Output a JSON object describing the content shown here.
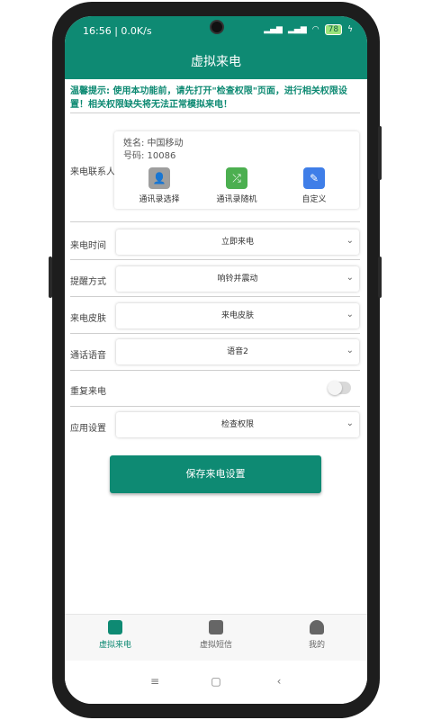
{
  "status_bar": {
    "time": "16:56 | 0.0K/s",
    "battery": "78"
  },
  "app_bar": {
    "title": "虚拟来电"
  },
  "notice": {
    "text": "温馨提示: 使用本功能前，请先打开\"检查权限\"页面，进行相关权限设置！相关权限缺失将无法正常模拟来电！"
  },
  "contact": {
    "label": "来电联系人",
    "name": "姓名: 中国移动",
    "number": "号码: 10086",
    "buttons": [
      {
        "label": "通讯录选择",
        "icon": "contacts-icon"
      },
      {
        "label": "通讯录随机",
        "icon": "shuffle-icon"
      },
      {
        "label": "自定义",
        "icon": "edit-icon"
      }
    ]
  },
  "settings": [
    {
      "label": "来电时间",
      "value": "立即来电"
    },
    {
      "label": "提醒方式",
      "value": "响铃并震动"
    },
    {
      "label": "来电皮肤",
      "value": "来电皮肤"
    },
    {
      "label": "通话语音",
      "value": "语音2"
    }
  ],
  "repeat": {
    "label": "重复来电",
    "enabled": false
  },
  "app_settings": {
    "label": "应用设置",
    "value": "检查权限"
  },
  "save_button": {
    "label": "保存来电设置"
  },
  "bottom_nav": [
    {
      "label": "虚拟来电",
      "icon": "phone-chat-icon",
      "active": true
    },
    {
      "label": "虚拟短信",
      "icon": "message-icon",
      "active": false
    },
    {
      "label": "我的",
      "icon": "user-icon",
      "active": false
    }
  ],
  "colors": {
    "brand": "#0e8a73",
    "shuffle_green": "#4caf50",
    "edit_blue": "#3f7ee8",
    "contacts_gray": "#9e9e9e"
  }
}
